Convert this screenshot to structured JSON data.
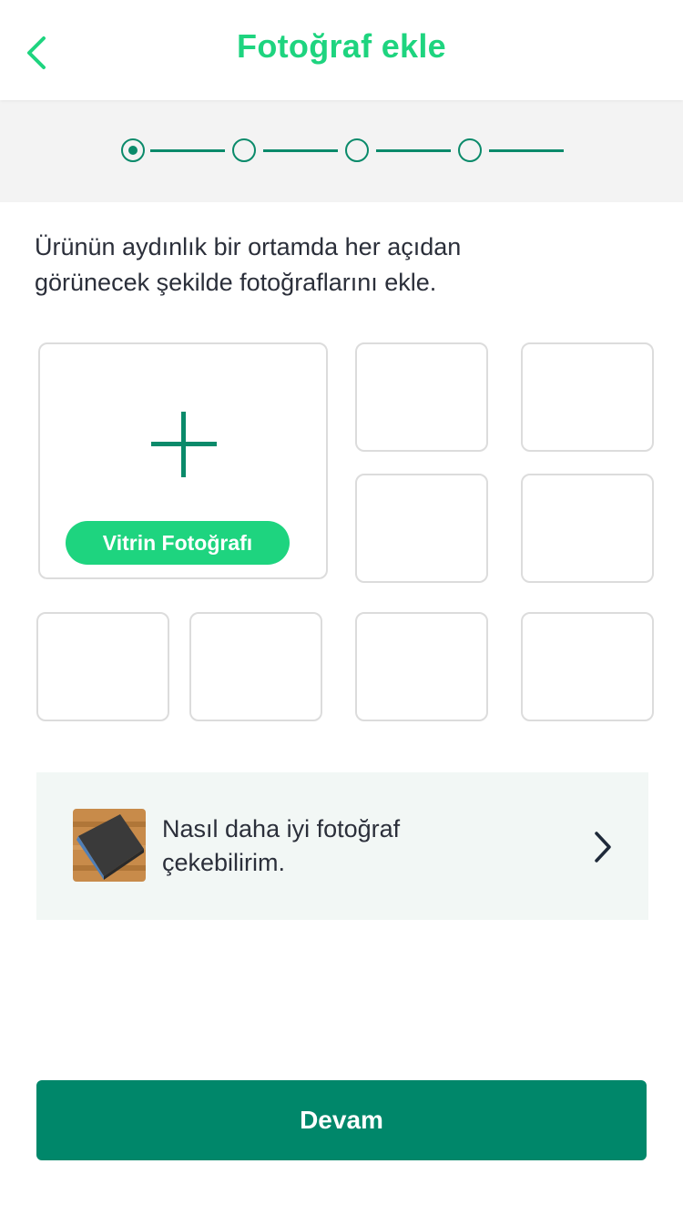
{
  "header": {
    "title": "Fotoğraf ekle",
    "back_icon": "chevron-left-icon"
  },
  "stepper": {
    "total_steps": 4,
    "current_step": 1
  },
  "instructions": {
    "line1": "Ürünün aydınlık bir ortamda her açıdan",
    "line2": "görünecek şekilde fotoğraflarını ekle."
  },
  "photo_grid": {
    "main_slot_label": "Vitrin Fotoğrafı",
    "add_icon": "plus-icon",
    "extra_slot_count": 8
  },
  "tip": {
    "line1": "Nasıl daha iyi fotoğraf",
    "line2": "çekebilirim.",
    "chevron_icon": "chevron-right-icon"
  },
  "footer": {
    "continue_label": "Devam"
  },
  "colors": {
    "accent_green": "#1ed47f",
    "dark_green": "#00876a",
    "text": "#2b2f3a"
  }
}
